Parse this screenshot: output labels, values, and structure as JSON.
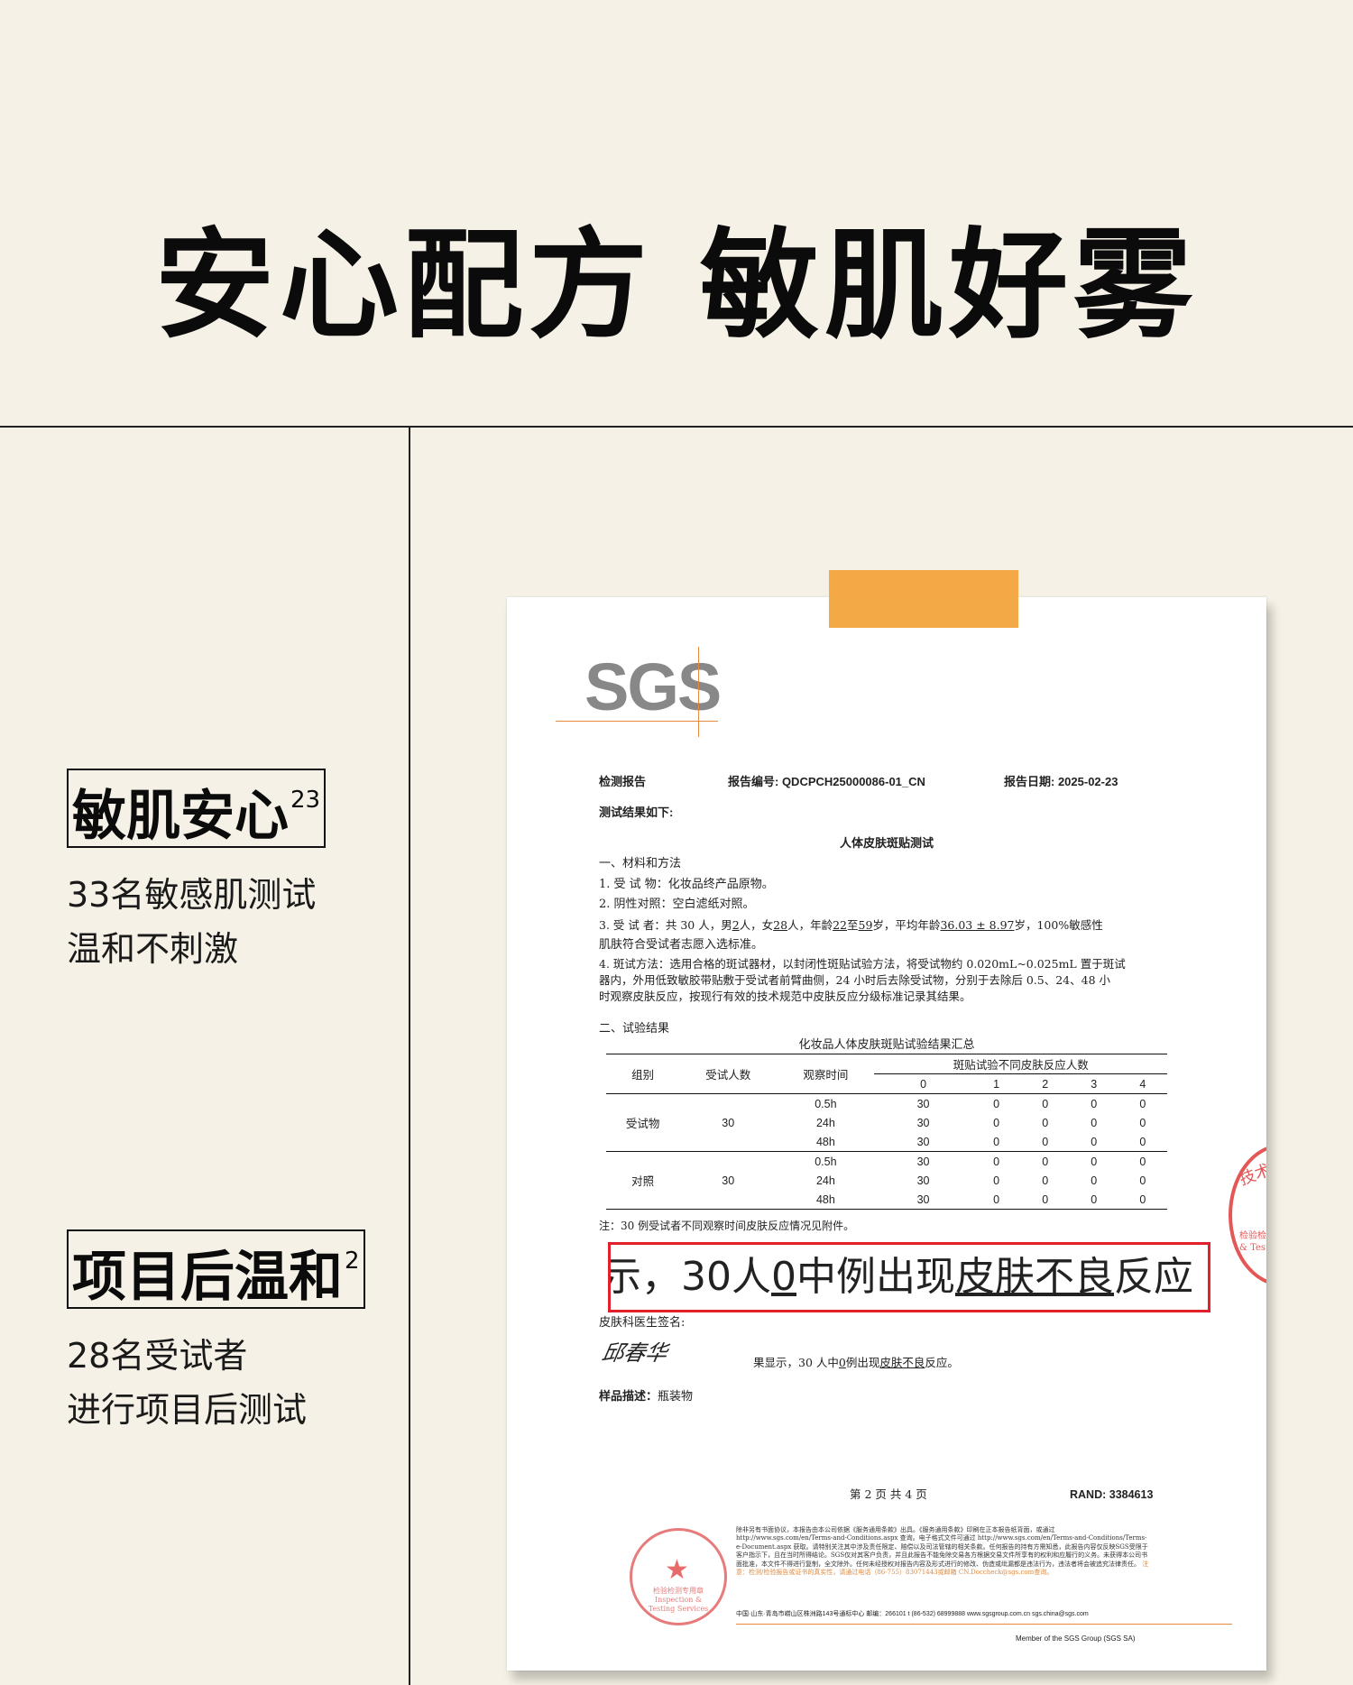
{
  "hero": {
    "title": "安心配方  敏肌好雾"
  },
  "features": [
    {
      "title": "敏肌安心",
      "sup": "23",
      "lines": [
        "33名敏感肌测试",
        "温和不刺激"
      ]
    },
    {
      "title": "项目后温和",
      "sup": "2",
      "lines": [
        "28名受试者",
        "进行项目后测试"
      ]
    }
  ],
  "report": {
    "logo": "SGS",
    "header": {
      "report_label": "检测报告",
      "report_no": "报告编号: QDCPCH25000086-01_CN",
      "report_date": "报告日期: 2025-02-23"
    },
    "results_intro": "测试结果如下:",
    "test_title": "人体皮肤斑贴测试",
    "section1": "一、材料和方法",
    "item1": "1. 受 试 物：化妆品终产品原物。",
    "item2": "2. 阴性对照：空白滤纸对照。",
    "item3": {
      "prefix": "3. 受 试 者：共 30 人，男",
      "male": "2",
      "mid1": "人，女",
      "female": "28",
      "mid2": "人，年龄",
      "age_min": "22",
      "mid3": "至",
      "age_max": "59",
      "mid4": "岁，平均年龄",
      "age_avg": "36.03 ± 8.97",
      "suffix": "岁，100%敏感性",
      "line2": "肌肤符合受试者志愿入选标准。"
    },
    "item4": [
      "4. 斑试方法：选用合格的斑试器材，以封闭性斑贴试验方法，将受试物约 0.020mL~0.025mL 置于斑试",
      "器内，外用低致敏胶带贴敷于受试者前臂曲侧，24 小时后去除受试物，分别于去除后 0.5、24、48 小",
      "时观察皮肤反应，按现行有效的技术规范中皮肤反应分级标准记录其结果。"
    ],
    "section2": "二、试验结果",
    "table_caption": "化妆品人体皮肤斑贴试验结果汇总",
    "table": {
      "h_group": "组别",
      "h_count": "受试人数",
      "h_time": "观察时间",
      "h_span": "斑贴试验不同皮肤反应人数",
      "grades": [
        "0",
        "1",
        "2",
        "3",
        "4"
      ],
      "groups": [
        {
          "name": "受试物",
          "count": "30",
          "rows": [
            {
              "time": "0.5h",
              "vals": [
                "30",
                "0",
                "0",
                "0",
                "0"
              ]
            },
            {
              "time": "24h",
              "vals": [
                "30",
                "0",
                "0",
                "0",
                "0"
              ]
            },
            {
              "time": "48h",
              "vals": [
                "30",
                "0",
                "0",
                "0",
                "0"
              ]
            }
          ]
        },
        {
          "name": "对照",
          "count": "30",
          "rows": [
            {
              "time": "0.5h",
              "vals": [
                "30",
                "0",
                "0",
                "0",
                "0"
              ]
            },
            {
              "time": "24h",
              "vals": [
                "30",
                "0",
                "0",
                "0",
                "0"
              ]
            },
            {
              "time": "48h",
              "vals": [
                "30",
                "0",
                "0",
                "0",
                "0"
              ]
            }
          ]
        }
      ]
    },
    "note": "注：30 例受试者不同观察时间皮肤反应情况见附件。",
    "highlight": {
      "a": "示，30人",
      "b": "0",
      "c": "中例出现",
      "d": "皮肤不良",
      "e": "反应"
    },
    "doctor_label": "皮肤科医生签名:",
    "signature": "邱春华",
    "result_line": {
      "a": "果显示，30 人中",
      "b": "0",
      "c": "例出现",
      "d": "皮肤不良",
      "e": "反应。"
    },
    "sample_label": "样品描述：",
    "sample_value": "瓶装物",
    "page": "第 2 页 共 4 页",
    "rand": "RAND: 3384613",
    "side_stamp": {
      "top": "技术服务",
      "bottom": "检验检测\nInspection & Testing"
    },
    "bottom_stamp": {
      "text": "检验检测专用章\nInspection & Testing Services"
    },
    "fineprint": "除非另有书面协议，本报告由本公司依据《服务通用条款》出具。《服务通用条款》印刷在正本报告纸背面，或通过 http://www.sgs.com/en/Terms-and-Conditions.aspx 查询。电子格式文件可通过 http://www.sgs.com/en/Terms-and-Conditions/Terms-e-Document.aspx 获取。请特别关注其中涉及责任限定、赔偿以及司法管辖的相关条款。任何报告的持有方需知悉，此报告内容仅反映SGS受限于客户指示下，且在当时所得结论。SGS仅对其客户负责，并且此报告不能免除交易各方根据交易文件所享有的权利和应履行的义务。未获得本公司书面批准，本文件不得进行复制，全文除外。任何未经授权对报告内容及形式进行的修改、伪造或纰漏都是违法行为，违法者将会被追究法律责任。",
    "fineprint_warn": "注意：检测/检验报告或证书的真实性，请通过电话（86-755）83071443或邮箱 CN.Doccheck@sgs.com查询。",
    "footer": "中国·山东·青岛市崂山区株洲路143号通标中心  邮编：266101     t (86-532) 68999888     www.sgsgroup.com.cn     sgs.china@sgs.com",
    "member": "Member of the SGS Group (SGS SA)"
  }
}
